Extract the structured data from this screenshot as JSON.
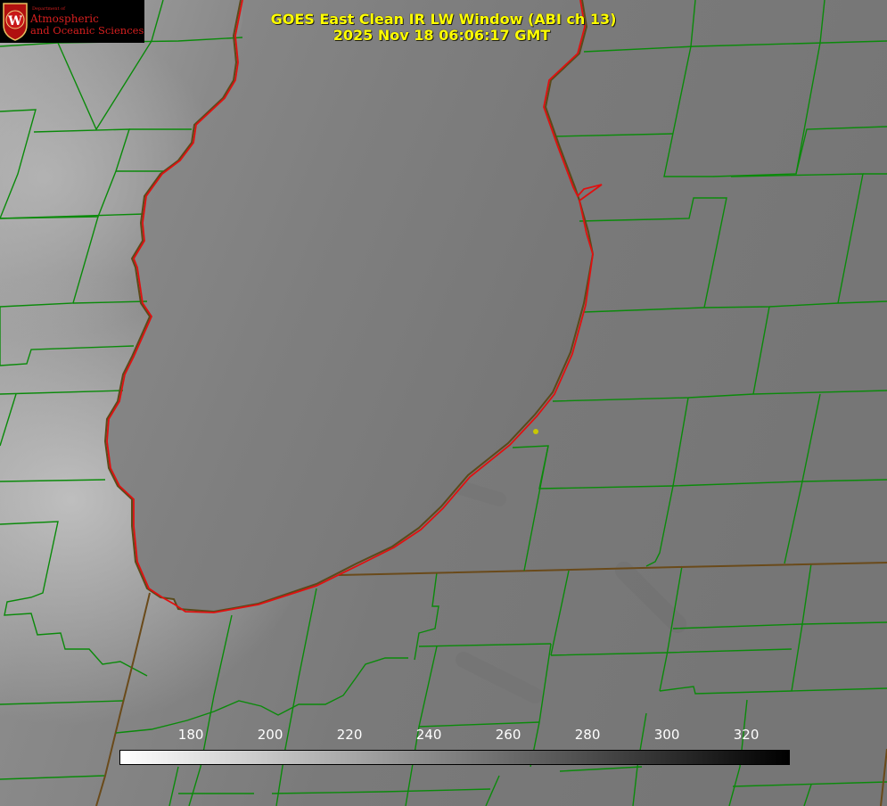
{
  "title": {
    "line1": "GOES East Clean IR LW Window (ABI ch 13)",
    "line2": "2025 Nov 18 06:06:17 GMT"
  },
  "logo": {
    "small_text": "Department of",
    "line1": "Atmospheric",
    "line2": "and Oceanic Sciences",
    "seal_letter": "W"
  },
  "colorbar": {
    "ticks": [
      "180",
      "200",
      "220",
      "240",
      "260",
      "280",
      "300",
      "320"
    ],
    "min": 162,
    "max": 331,
    "start_color": "#ffffff",
    "end_color": "#000000"
  },
  "colors": {
    "county_lines": "#0a8a0a",
    "lake_outline": "#e01010",
    "title_text": "#ffff00",
    "marker": "#c8c800"
  }
}
